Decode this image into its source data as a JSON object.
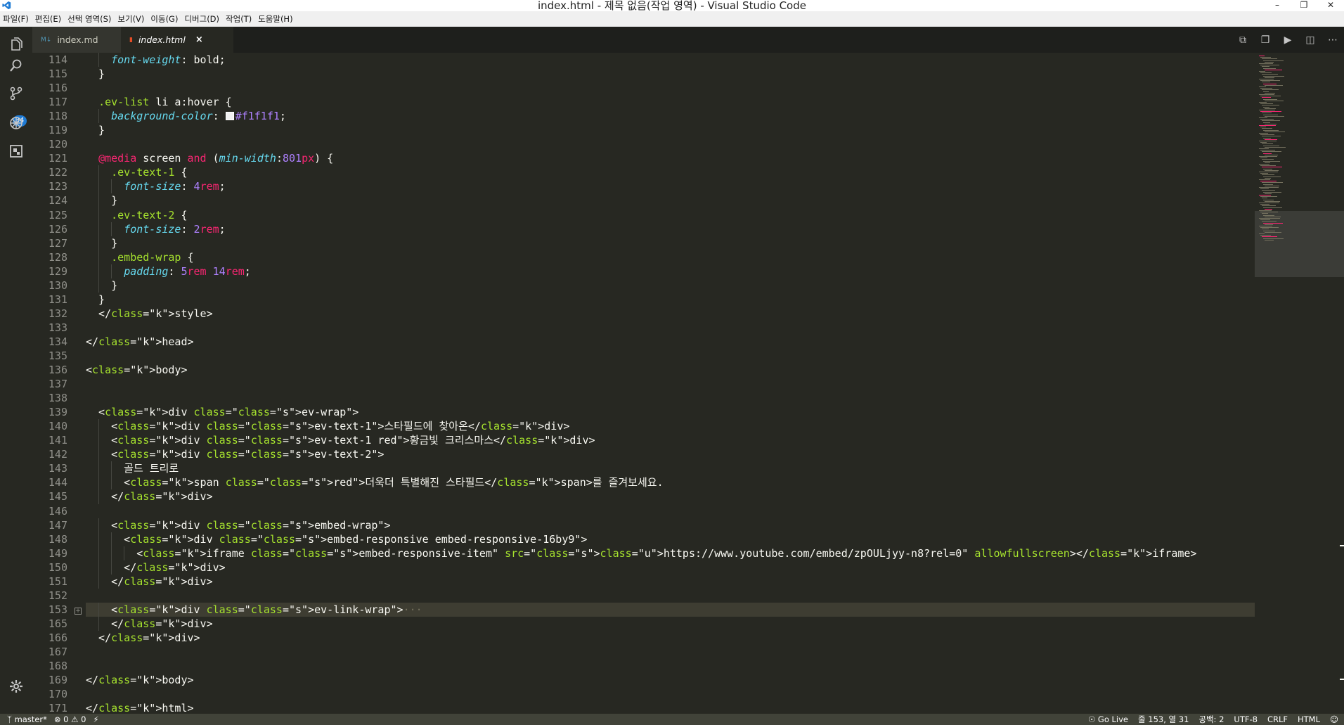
{
  "window": {
    "title": "index.html - 제목 없음(작업 영역) - Visual Studio Code"
  },
  "menu": [
    "파일(F)",
    "편집(E)",
    "선택 영역(S)",
    "보기(V)",
    "이동(G)",
    "디버그(D)",
    "작업(T)",
    "도움말(H)"
  ],
  "activity": {
    "scm_badge": "34"
  },
  "tabs": [
    {
      "label": "index.md",
      "icon": "markdown-icon",
      "active": false
    },
    {
      "label": "index.html",
      "icon": "html-icon",
      "active": true
    }
  ],
  "editor": {
    "current_line": 153,
    "lines": [
      {
        "n": "114",
        "t": "    font-weight: bold;"
      },
      {
        "n": "115",
        "t": "  }"
      },
      {
        "n": "116",
        "t": ""
      },
      {
        "n": "117",
        "t": "  .ev-list li a:hover {"
      },
      {
        "n": "118",
        "t": "    background-color: #f1f1f1;"
      },
      {
        "n": "119",
        "t": "  }"
      },
      {
        "n": "120",
        "t": ""
      },
      {
        "n": "121",
        "t": "  @media screen and (min-width:801px) {"
      },
      {
        "n": "122",
        "t": "    .ev-text-1 {"
      },
      {
        "n": "123",
        "t": "      font-size: 4rem;"
      },
      {
        "n": "124",
        "t": "    }"
      },
      {
        "n": "125",
        "t": "    .ev-text-2 {"
      },
      {
        "n": "126",
        "t": "      font-size: 2rem;"
      },
      {
        "n": "127",
        "t": "    }"
      },
      {
        "n": "128",
        "t": "    .embed-wrap {"
      },
      {
        "n": "129",
        "t": "      padding: 5rem 14rem;"
      },
      {
        "n": "130",
        "t": "    }"
      },
      {
        "n": "131",
        "t": "  }"
      },
      {
        "n": "132",
        "t": "  </style>"
      },
      {
        "n": "133",
        "t": ""
      },
      {
        "n": "134",
        "t": "</head>"
      },
      {
        "n": "135",
        "t": ""
      },
      {
        "n": "136",
        "t": "<body>"
      },
      {
        "n": "137",
        "t": ""
      },
      {
        "n": "138",
        "t": ""
      },
      {
        "n": "139",
        "t": "  <div class=\"ev-wrap\">"
      },
      {
        "n": "140",
        "t": "    <div class=\"ev-text-1\">스타필드에 찾아온</div>"
      },
      {
        "n": "141",
        "t": "    <div class=\"ev-text-1 red\">황금빛 크리스마스</div>"
      },
      {
        "n": "142",
        "t": "    <div class=\"ev-text-2\">"
      },
      {
        "n": "143",
        "t": "      골드 트리로"
      },
      {
        "n": "144",
        "t": "      <span class=\"red\">더욱더 특별해진 스타필드</span>를 즐겨보세요."
      },
      {
        "n": "145",
        "t": "    </div>"
      },
      {
        "n": "146",
        "t": ""
      },
      {
        "n": "147",
        "t": "    <div class=\"embed-wrap\">"
      },
      {
        "n": "148",
        "t": "      <div class=\"embed-responsive embed-responsive-16by9\">"
      },
      {
        "n": "149",
        "t": "        <iframe class=\"embed-responsive-item\" src=\"https://www.youtube.com/embed/zpOULjyy-n8?rel=0\" allowfullscreen></iframe>"
      },
      {
        "n": "150",
        "t": "      </div>"
      },
      {
        "n": "151",
        "t": "    </div>"
      },
      {
        "n": "152",
        "t": ""
      },
      {
        "n": "153",
        "t": "    <div class=\"ev-link-wrap\">···"
      },
      {
        "n": "165",
        "t": "    </div>"
      },
      {
        "n": "166",
        "t": "  </div>"
      },
      {
        "n": "167",
        "t": ""
      },
      {
        "n": "168",
        "t": ""
      },
      {
        "n": "169",
        "t": "</body>"
      },
      {
        "n": "170",
        "t": ""
      },
      {
        "n": "171",
        "t": "</html>"
      }
    ]
  },
  "status": {
    "branch": "master*",
    "errors": "0",
    "warnings": "0",
    "golive": "Go Live",
    "position": "줄 153, 열 31",
    "spaces": "공백: 2",
    "encoding": "UTF-8",
    "eol": "CRLF",
    "language": "HTML"
  },
  "colors": {
    "background": "#272822",
    "keyword": "#f92672",
    "string": "#e6db74",
    "number": "#ae81ff",
    "property": "#66d9ef",
    "status_bar": "#414339"
  }
}
